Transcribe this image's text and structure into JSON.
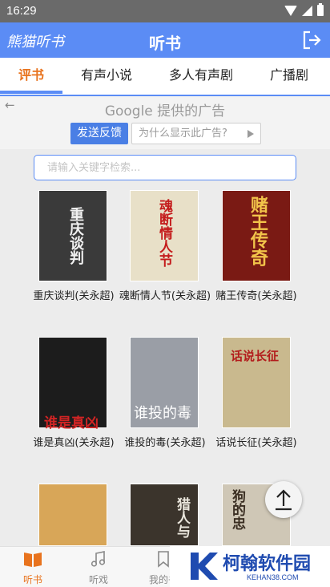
{
  "status_bar": {
    "time": "16:29"
  },
  "app_bar": {
    "brand": "熊猫听书",
    "title": "听书"
  },
  "tabs": [
    {
      "label": "评书",
      "active": true
    },
    {
      "label": "有声小说",
      "active": false
    },
    {
      "label": "多人有声剧",
      "active": false
    },
    {
      "label": "广播剧",
      "active": false
    }
  ],
  "ad": {
    "notice": "Google 提供的广告",
    "feedback_label": "发送反馈",
    "why_label": "为什么显示此广告?"
  },
  "search": {
    "placeholder": "请输入关键字检索..."
  },
  "books": [
    {
      "title": "重庆谈判(关永超)",
      "cover_text": "重庆谈判",
      "cover_color": "#3a3a3a"
    },
    {
      "title": "魂断情人节(关永超)",
      "cover_text": "魂断情人节",
      "cover_color": "#e8e0c8"
    },
    {
      "title": "赌王传奇(关永超)",
      "cover_text": "赌王传奇",
      "cover_color": "#7a1a14"
    },
    {
      "title": "谁是真凶(关永超)",
      "cover_text": "谁是真凶",
      "cover_color": "#1c1c1c"
    },
    {
      "title": "谁投的毒(关永超)",
      "cover_text": "谁投的毒",
      "cover_color": "#9a9ea6"
    },
    {
      "title": "话说长征(关永超)",
      "cover_text": "话说长征",
      "cover_color": "#c9b98e"
    },
    {
      "title": "",
      "cover_text": "",
      "cover_color": "#d8a658"
    },
    {
      "title": "",
      "cover_text": "猎人与",
      "cover_color": "#3b342c"
    },
    {
      "title": "",
      "cover_text": "狗的忠",
      "cover_color": "#cfc7b6"
    }
  ],
  "bottom_nav": [
    {
      "label": "听书",
      "active": true
    },
    {
      "label": "听戏",
      "active": false
    },
    {
      "label": "我的书",
      "active": false
    }
  ],
  "watermark": {
    "name": "柯翰软件园",
    "url": "KEHAN38.COM"
  },
  "colors": {
    "primary": "#5b8cf5",
    "accent": "#e8731e"
  }
}
